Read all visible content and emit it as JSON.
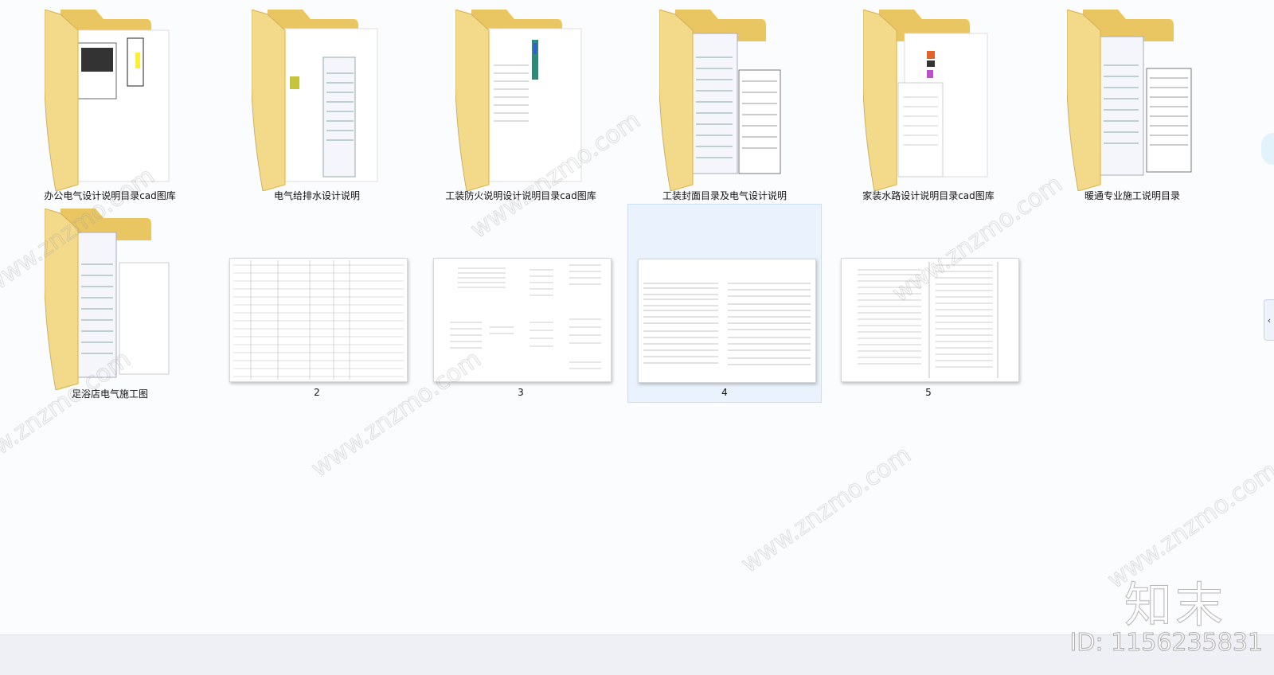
{
  "items": [
    {
      "name": "办公电气设计说明目录cad图库",
      "type": "folder"
    },
    {
      "name": "电气给排水设计说明",
      "type": "folder"
    },
    {
      "name": "工装防火说明设计说明目录cad图库",
      "type": "folder"
    },
    {
      "name": "工装封面目录及电气设计说明",
      "type": "folder"
    },
    {
      "name": "家装水路设计说明目录cad图库",
      "type": "folder"
    },
    {
      "name": "暖通专业施工说明目录",
      "type": "folder"
    },
    {
      "name": "足浴店电气施工图",
      "type": "folder"
    },
    {
      "name": "2",
      "type": "image"
    },
    {
      "name": "3",
      "type": "image"
    },
    {
      "name": "4",
      "type": "image",
      "selected": true
    },
    {
      "name": "5",
      "type": "image"
    }
  ],
  "watermark": {
    "url_text": "www.znzmo.com",
    "brand": "知末",
    "id_text": "ID: 1156235831"
  },
  "scroll_arrow": "‹",
  "colors": {
    "folder_front": "#f3d98a",
    "folder_back": "#e9c661",
    "selection": "#eaf3fd"
  }
}
